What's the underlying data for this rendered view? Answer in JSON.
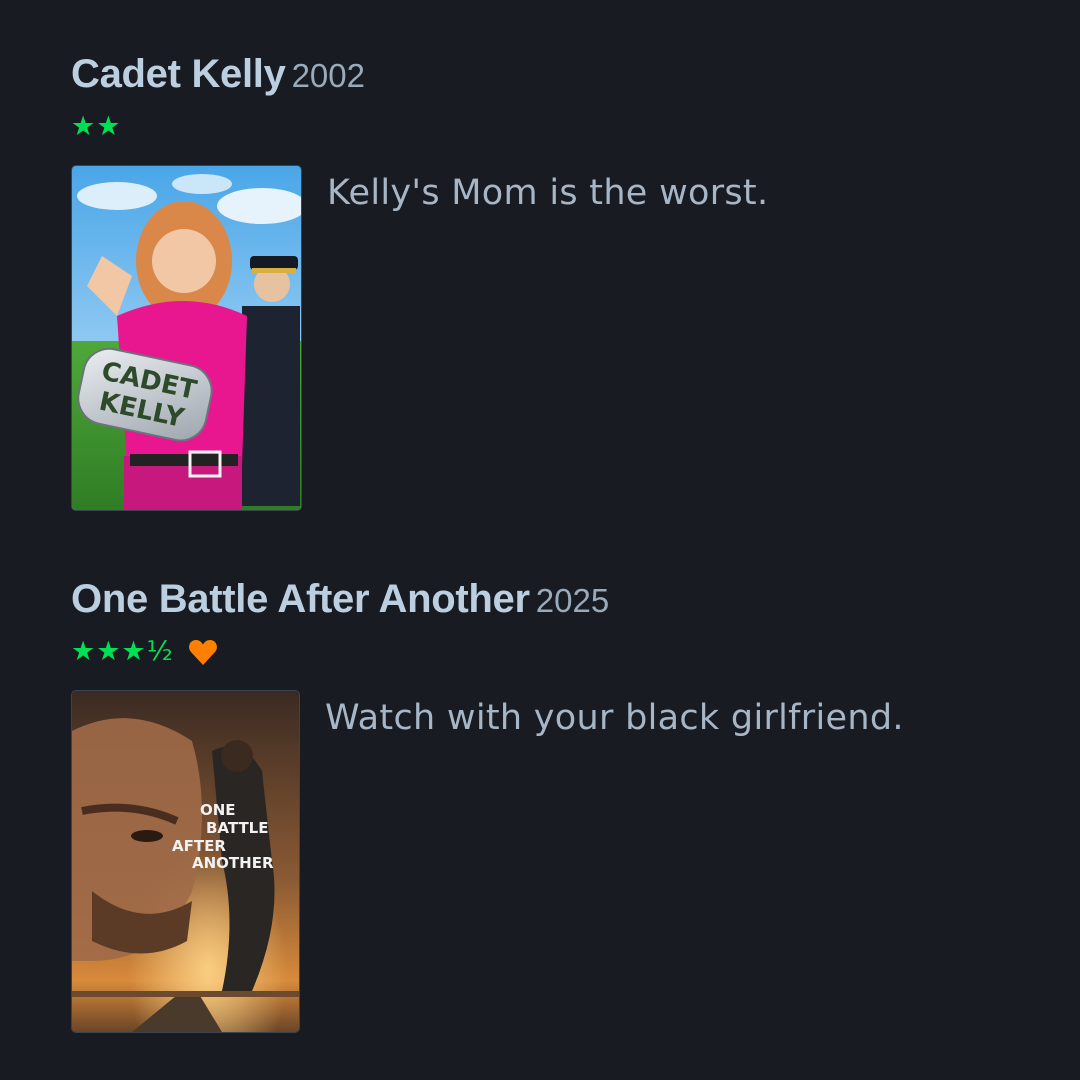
{
  "reviews": [
    {
      "title": "Cadet Kelly",
      "year": "2002",
      "stars": "★★",
      "liked": false,
      "poster_text": [
        "CADET",
        "KELLY"
      ],
      "text": "Kelly's Mom is the worst."
    },
    {
      "title": "One Battle After Another",
      "year": "2025",
      "stars": "★★★½",
      "liked": true,
      "poster_text": [
        "ONE",
        "BATTLE",
        "AFTER",
        "ANOTHER"
      ],
      "text": "Watch with your black girlfriend."
    }
  ],
  "colors": {
    "background": "#181b21",
    "star_green": "#00e054",
    "heart_orange": "#ff8000",
    "title": "#bccfe0",
    "text": "#a7b6c6"
  }
}
